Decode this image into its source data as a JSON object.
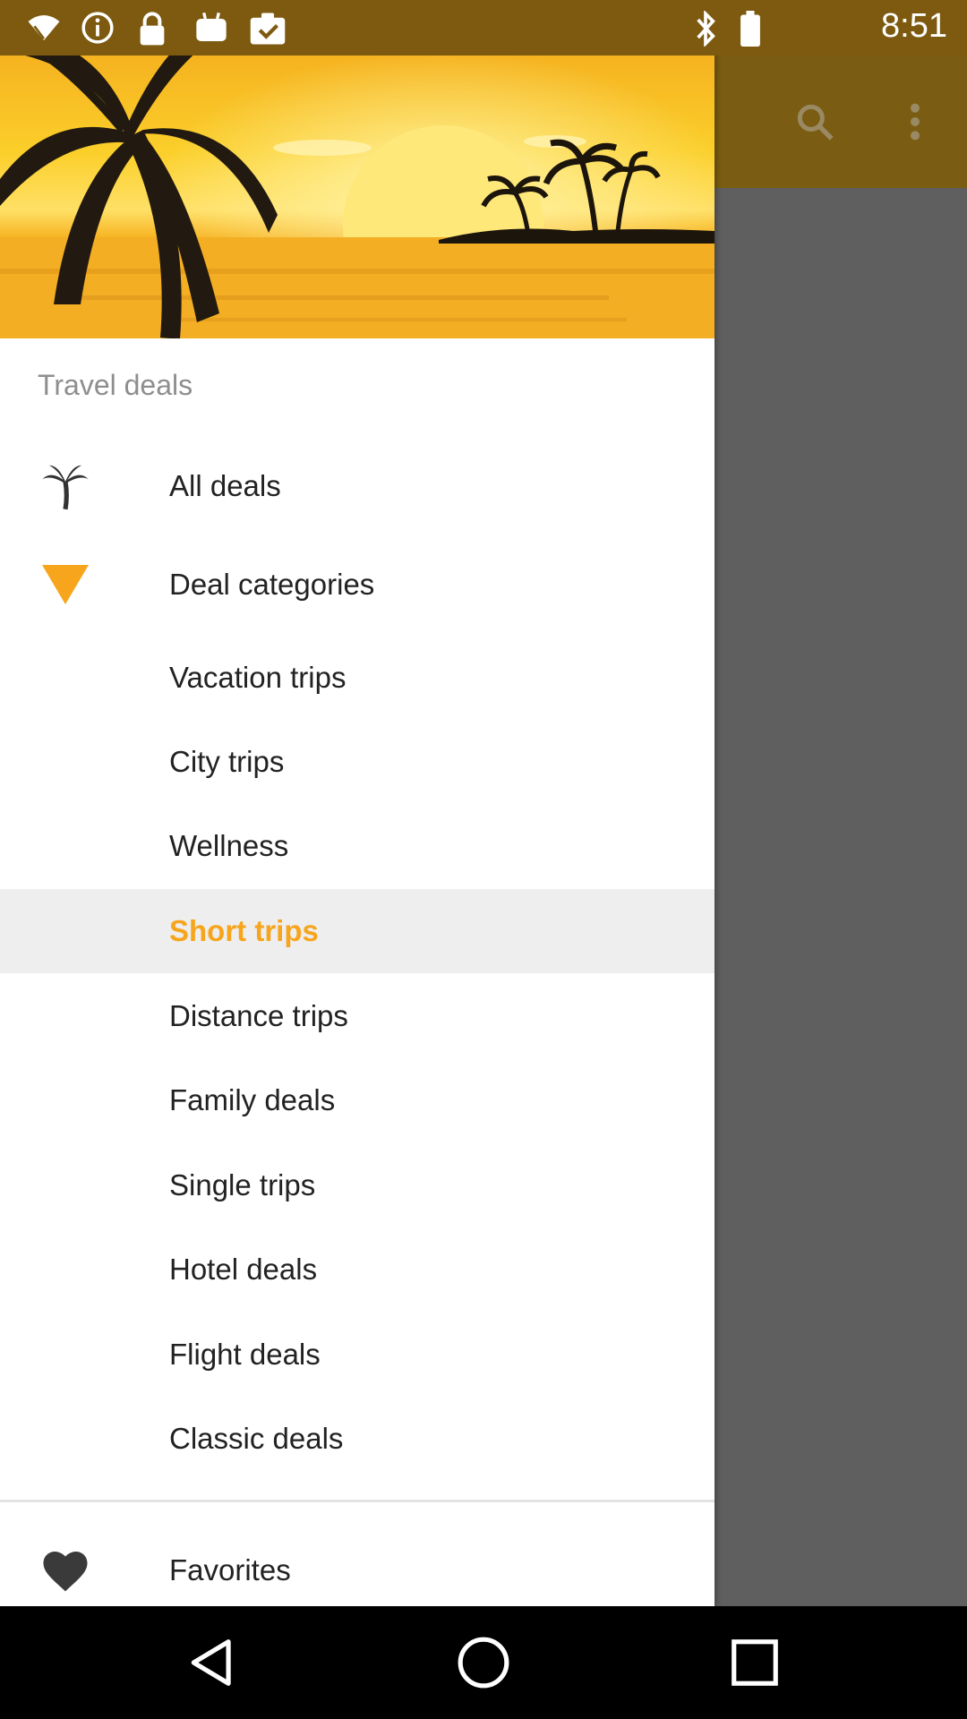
{
  "status_bar": {
    "time": "8:51",
    "icons": [
      "wifi-icon",
      "info-icon",
      "lock-icon",
      "android-icon",
      "clipboard-check-icon",
      "bluetooth-icon",
      "battery-icon"
    ]
  },
  "toolbar": {
    "icons": [
      "search-icon",
      "overflow-menu-icon"
    ]
  },
  "drawer": {
    "header_image": "tropical-sunset-palm-trees",
    "section_title": "Travel deals",
    "items": [
      {
        "label": "All deals",
        "icon": "palm-tree-icon"
      },
      {
        "label": "Deal categories",
        "icon": "triangle-down-icon"
      },
      {
        "label": "Vacation trips"
      },
      {
        "label": "City trips"
      },
      {
        "label": "Wellness"
      },
      {
        "label": "Short trips",
        "active": true
      },
      {
        "label": "Distance trips"
      },
      {
        "label": "Family deals"
      },
      {
        "label": "Single trips"
      },
      {
        "label": "Hotel deals"
      },
      {
        "label": "Flight deals"
      },
      {
        "label": "Classic deals"
      }
    ],
    "footer_items": [
      {
        "label": "Favorites",
        "icon": "heart-icon"
      }
    ]
  },
  "colors": {
    "accent": "#f7a51c",
    "toolbar": "#7a5d12",
    "scrim": "#5f5f5f"
  },
  "nav_bar": {
    "icons": [
      "back-icon",
      "home-icon",
      "recents-icon"
    ]
  }
}
